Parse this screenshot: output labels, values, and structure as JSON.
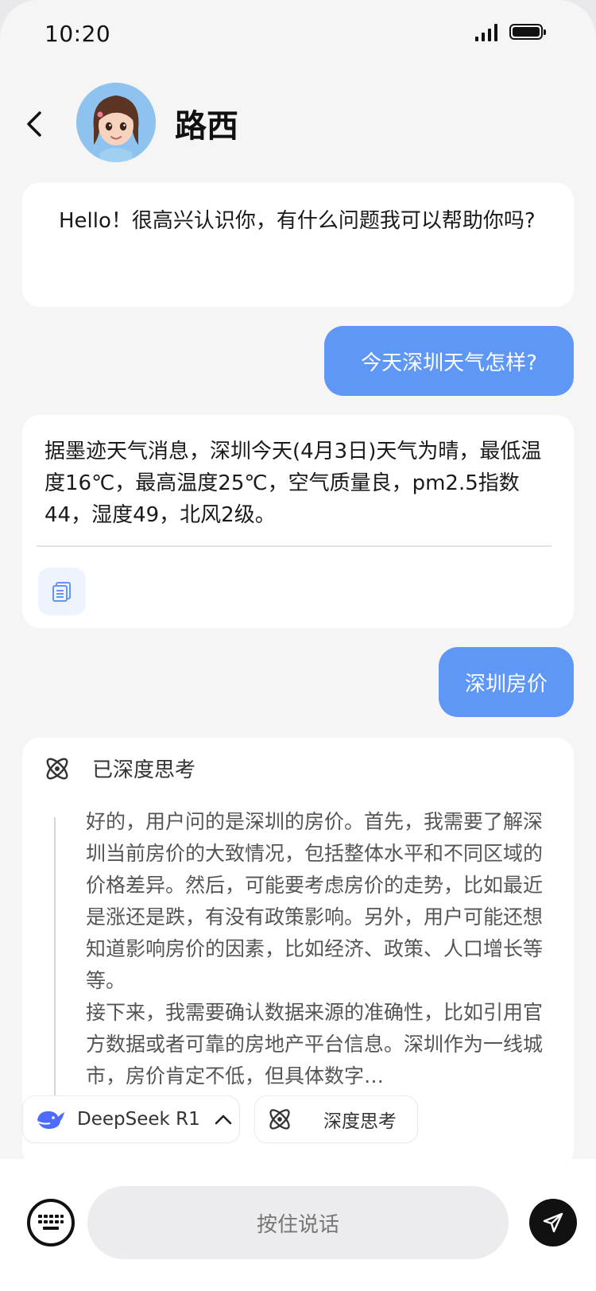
{
  "status_bar": {
    "time": "10:20"
  },
  "header": {
    "contact_name": "路西"
  },
  "messages": {
    "greeting": "Hello！很高兴认识你，有什么问题我可以帮助你吗?",
    "user_weather": "今天深圳天气怎样?",
    "weather_answer": "据墨迹天气消息，深圳今天(4月3日)天气为晴，最低温度16℃，最高温度25℃，空气质量良，pm2.5指数44，湿度49，北风2级。",
    "user_price": "深圳房价",
    "think_label": "已深度思考",
    "think_text": "好的，用户问的是深圳的房价。首先，我需要了解深圳当前房价的大致情况，包括整体水平和不同区域的价格差异。然后，可能要考虑房价的走势，比如最近是涨还是跌，有没有政策影响。另外，用户可能还想知道影响房价的因素，比如经济、政策、人口增长等等。\n接下来，我需要确认数据来源的准确性，比如引用官方数据或者可靠的房地产平台信息。深圳作为一线城市，房价肯定不低，但具体数字…"
  },
  "chips": {
    "model_label": "DeepSeek R1",
    "deep_think_label": "深度思考"
  },
  "input": {
    "voice_label": "按住说话"
  },
  "colors": {
    "accent": "#5e97f6",
    "background": "#f5f5f6",
    "deepseek_brand": "#4d6bfe"
  }
}
